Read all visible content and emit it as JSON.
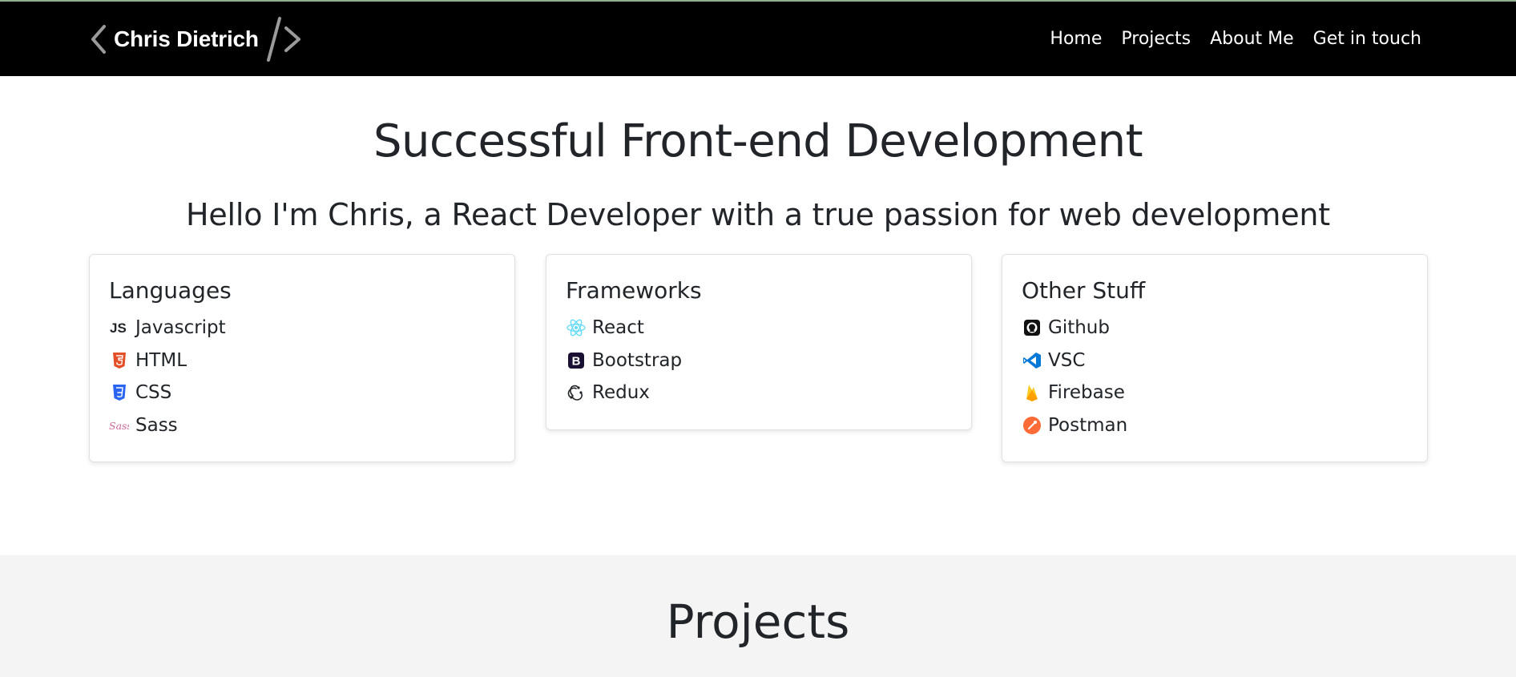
{
  "brand": {
    "name": "Chris Dietrich"
  },
  "nav": {
    "items": [
      "Home",
      "Projects",
      "About Me",
      "Get in touch"
    ]
  },
  "hero": {
    "title": "Successful Front-end Development",
    "subtitle": "Hello I'm Chris, a React Developer with a true passion for web development"
  },
  "cards": [
    {
      "title": "Languages",
      "items": [
        {
          "label": "Javascript",
          "icon": "javascript-icon"
        },
        {
          "label": "HTML",
          "icon": "html5-icon"
        },
        {
          "label": "CSS",
          "icon": "css3-icon"
        },
        {
          "label": "Sass",
          "icon": "sass-icon"
        }
      ]
    },
    {
      "title": "Frameworks",
      "items": [
        {
          "label": "React",
          "icon": "react-icon"
        },
        {
          "label": "Bootstrap",
          "icon": "bootstrap-icon"
        },
        {
          "label": "Redux",
          "icon": "redux-icon"
        }
      ]
    },
    {
      "title": "Other Stuff",
      "items": [
        {
          "label": "Github",
          "icon": "github-icon"
        },
        {
          "label": "VSC",
          "icon": "vscode-icon"
        },
        {
          "label": "Firebase",
          "icon": "firebase-icon"
        },
        {
          "label": "Postman",
          "icon": "postman-icon"
        }
      ]
    }
  ],
  "projects": {
    "title": "Projects"
  },
  "colors": {
    "navbar": "#000000",
    "text": "#212529",
    "band": "#f4f4f4",
    "html5": "#e34f26",
    "css3": "#2965f1",
    "sass": "#cc6699",
    "react": "#61dafb",
    "bootstrap": "#1a1033",
    "vscode": "#0078d7",
    "firebase": "#ffca28",
    "postman": "#ff6c37"
  }
}
